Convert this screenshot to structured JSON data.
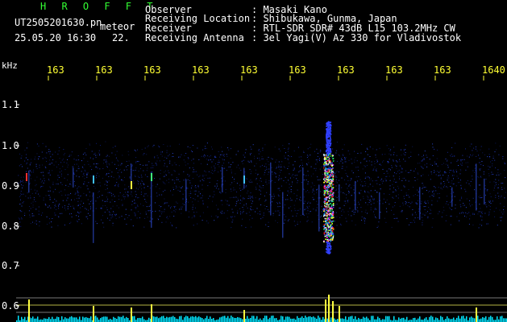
{
  "header": {
    "program": "H R O F F T",
    "filename": "UT2505201630.pn",
    "mode": "meteor",
    "datetime": "25.05.20 16:30",
    "count": "22.",
    "fields": [
      {
        "label": "Observer",
        "value": ": Masaki Kano"
      },
      {
        "label": "Receiving Location",
        "value": ": Shibukawa, Gunma, Japan"
      },
      {
        "label": "Receiver",
        "value": ": RTL-SDR SDR# 43dB L15 103.2MHz CW"
      },
      {
        "label": "Receiving Antenna",
        "value": ": 3el Yagi(V) Az 330 for Vladivostok"
      }
    ]
  },
  "axis": {
    "unit_label": "kHz",
    "y_ticks": [
      "1.1",
      "1.0",
      "0.9",
      "0.8",
      "0.7",
      "0.6"
    ],
    "time_ticks": [
      "163",
      "163",
      "163",
      "163",
      "163",
      "163",
      "163",
      "163",
      "163",
      "1640"
    ]
  },
  "colors": {
    "background": "#000000",
    "text": "#ffffff",
    "title": "#33ff33",
    "ticks": "#ffff33",
    "baseline": "#00e5ff"
  }
}
